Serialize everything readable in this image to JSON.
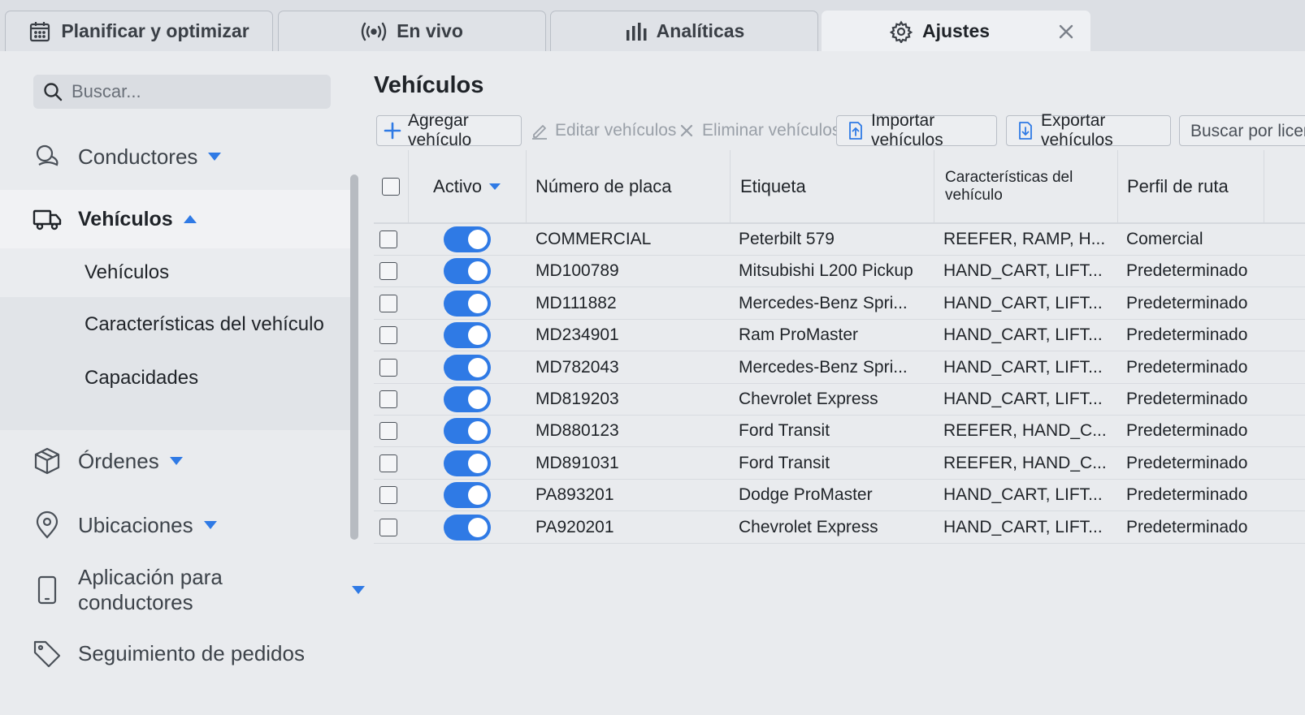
{
  "tabs": [
    {
      "label": "Planificar y optimizar",
      "icon": "calendar-icon",
      "active": false
    },
    {
      "label": "En vivo",
      "icon": "broadcast-icon",
      "active": false
    },
    {
      "label": "Analíticas",
      "icon": "bar-chart-icon",
      "active": false
    },
    {
      "label": "Ajustes",
      "icon": "gear-icon",
      "active": true
    }
  ],
  "sidebar": {
    "search_placeholder": "Buscar...",
    "items": [
      {
        "label": "Conductores",
        "icon": "drivers-icon"
      },
      {
        "label": "Vehículos",
        "icon": "truck-icon",
        "expanded": true
      },
      {
        "label": "Órdenes",
        "icon": "box-icon"
      },
      {
        "label": "Ubicaciones",
        "icon": "location-pin-icon"
      },
      {
        "label": "Aplicación para conductores",
        "icon": "phone-icon"
      },
      {
        "label": "Seguimiento de pedidos",
        "icon": "tag-icon"
      }
    ],
    "vehicle_subitems": [
      "Vehículos",
      "Características del vehículo",
      "Capacidades"
    ],
    "selected_subitem": "Vehículos"
  },
  "main": {
    "title": "Vehículos",
    "toolbar": {
      "add": "Agregar vehículo",
      "edit": "Editar vehículos",
      "delete": "Eliminar vehículos",
      "import": "Importar vehículos",
      "export": "Exportar vehículos",
      "search_placeholder": "Buscar por licencia"
    },
    "columns": [
      "Activo",
      "Número de placa",
      "Etiqueta",
      "Características del vehículo",
      "Perfil de ruta"
    ],
    "rows": [
      {
        "active": true,
        "plate": "COMMERCIAL",
        "tag": "Peterbilt 579",
        "features": "REEFER, RAMP, H...",
        "profile": "Comercial"
      },
      {
        "active": true,
        "plate": "MD100789",
        "tag": "Mitsubishi L200 Pickup",
        "features": "HAND_CART, LIFT...",
        "profile": "Predeterminado"
      },
      {
        "active": true,
        "plate": "MD111882",
        "tag": "Mercedes-Benz Spri...",
        "features": "HAND_CART, LIFT...",
        "profile": "Predeterminado"
      },
      {
        "active": true,
        "plate": "MD234901",
        "tag": "Ram ProMaster",
        "features": "HAND_CART, LIFT...",
        "profile": "Predeterminado"
      },
      {
        "active": true,
        "plate": "MD782043",
        "tag": "Mercedes-Benz Spri...",
        "features": "HAND_CART, LIFT...",
        "profile": "Predeterminado"
      },
      {
        "active": true,
        "plate": "MD819203",
        "tag": "Chevrolet Express",
        "features": "HAND_CART, LIFT...",
        "profile": "Predeterminado"
      },
      {
        "active": true,
        "plate": "MD880123",
        "tag": "Ford Transit",
        "features": "REEFER, HAND_C...",
        "profile": "Predeterminado"
      },
      {
        "active": true,
        "plate": "MD891031",
        "tag": "Ford Transit",
        "features": "REEFER, HAND_C...",
        "profile": "Predeterminado"
      },
      {
        "active": true,
        "plate": "PA893201",
        "tag": "Dodge ProMaster",
        "features": "HAND_CART, LIFT...",
        "profile": "Predeterminado"
      },
      {
        "active": true,
        "plate": "PA920201",
        "tag": "Chevrolet Express",
        "features": "HAND_CART, LIFT...",
        "profile": "Predeterminado"
      }
    ]
  },
  "colors": {
    "accent": "#2f7ae5",
    "background": "#e9ebee",
    "text": "#1f2328"
  }
}
